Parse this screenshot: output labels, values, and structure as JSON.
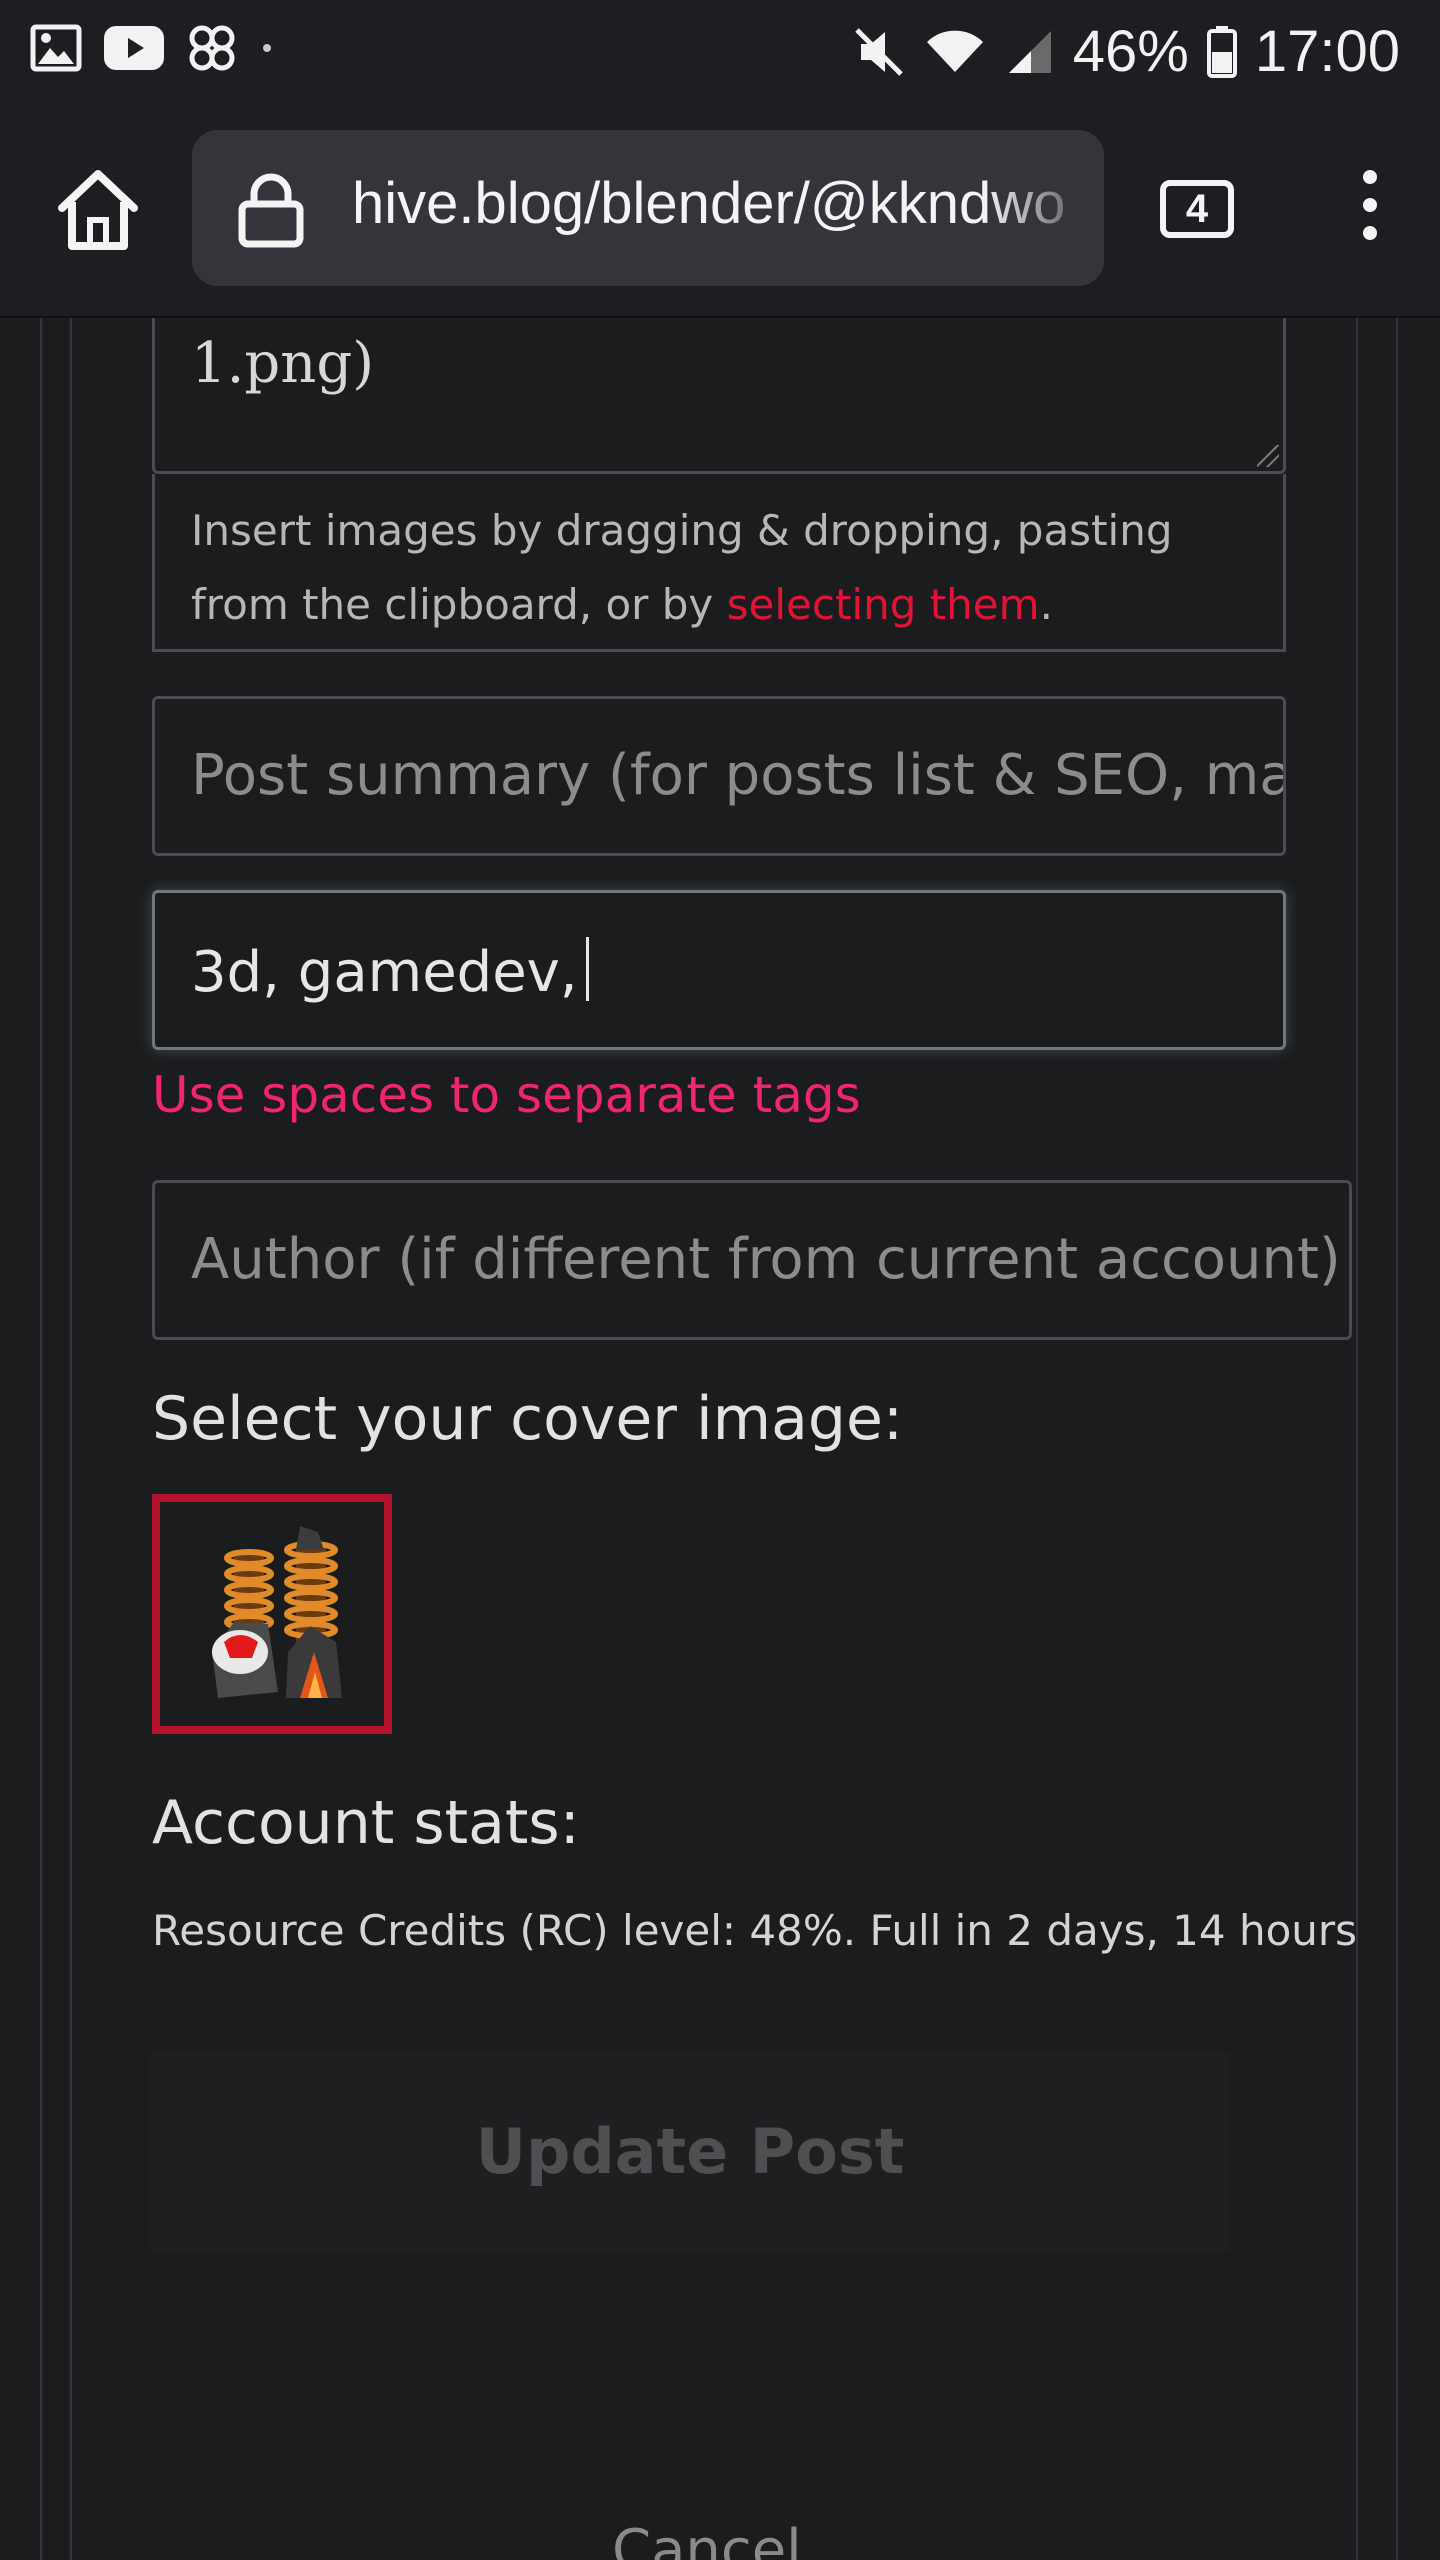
{
  "status_bar": {
    "icons_left": [
      "gallery-icon",
      "youtube-icon",
      "pinwheel-icon",
      "dot-icon"
    ],
    "icons_right": [
      "mute-icon",
      "wifi-icon",
      "signal-icon",
      "battery-icon"
    ],
    "battery": "46%",
    "time": "17:00"
  },
  "browser": {
    "url": "hive.blog/blender/@kkndwo",
    "tab_count": "4"
  },
  "editor": {
    "body_tail": "1.png)",
    "drop_hint_prefix": "Insert images by dragging & dropping, pasting from the clipboard, or by ",
    "drop_hint_link": "selecting them",
    "drop_hint_suffix": ".",
    "summary_placeholder": "Post summary (for posts list & SEO, max",
    "tags_value": "3d, gamedev,",
    "tags_error": "Use spaces to separate tags",
    "author_placeholder": "Author (if different from current account)",
    "cover_label": "Select your cover image:",
    "account_stats_label": "Account stats:",
    "rc_text": "Resource Credits (RC) level: 48%. Full in 2 days, 14 hours",
    "update_button": "Update Post",
    "cancel_button": "Cancel"
  },
  "colors": {
    "link_red": "#e31337",
    "error_pink": "#f0246f",
    "cover_border": "#b3122e"
  }
}
